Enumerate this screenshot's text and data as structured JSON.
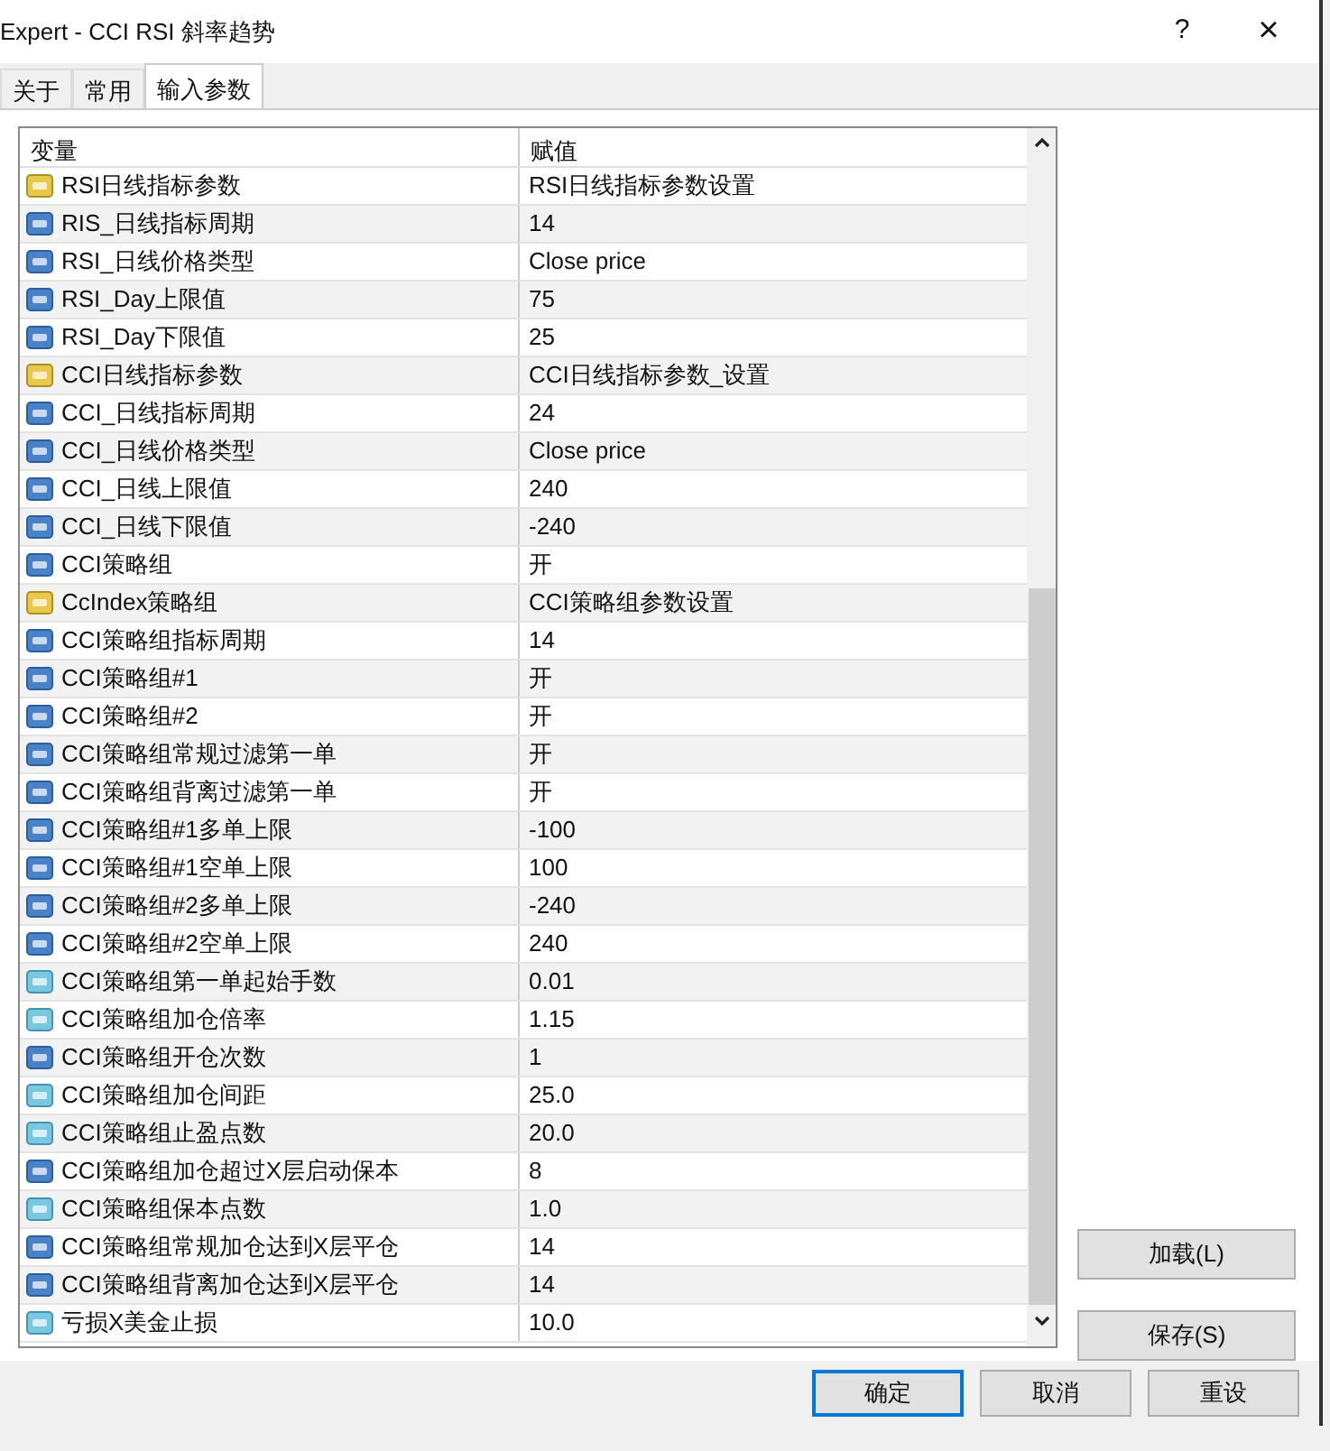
{
  "window": {
    "title": "Expert - CCI RSI 斜率趋势",
    "help": "?",
    "close": "×"
  },
  "tabs": [
    {
      "label": "关于",
      "selected": false
    },
    {
      "label": "常用",
      "selected": false
    },
    {
      "label": "输入参数",
      "selected": true
    }
  ],
  "table": {
    "columns": [
      "变量",
      "赋值"
    ],
    "rows": [
      {
        "kind": "string",
        "name": "RSI日线指标参数",
        "value": "RSI日线指标参数设置"
      },
      {
        "kind": "int",
        "name": "RIS_日线指标周期",
        "value": "14"
      },
      {
        "kind": "int",
        "name": "RSI_日线价格类型",
        "value": "Close price"
      },
      {
        "kind": "int",
        "name": "RSI_Day上限值",
        "value": "75"
      },
      {
        "kind": "int",
        "name": "RSI_Day下限值",
        "value": "25"
      },
      {
        "kind": "string",
        "name": "CCI日线指标参数",
        "value": "CCI日线指标参数_设置"
      },
      {
        "kind": "int",
        "name": "CCI_日线指标周期",
        "value": "24"
      },
      {
        "kind": "int",
        "name": "CCI_日线价格类型",
        "value": "Close price"
      },
      {
        "kind": "int",
        "name": "CCI_日线上限值",
        "value": "240"
      },
      {
        "kind": "int",
        "name": "CCI_日线下限值",
        "value": "-240"
      },
      {
        "kind": "int",
        "name": "CCI策略组",
        "value": "开"
      },
      {
        "kind": "string",
        "name": "CcIndex策略组",
        "value": "CCI策略组参数设置"
      },
      {
        "kind": "int",
        "name": "CCI策略组指标周期",
        "value": "14"
      },
      {
        "kind": "int",
        "name": "CCI策略组#1",
        "value": "开"
      },
      {
        "kind": "int",
        "name": "CCI策略组#2",
        "value": "开"
      },
      {
        "kind": "int",
        "name": "CCI策略组常规过滤第一单",
        "value": "开"
      },
      {
        "kind": "int",
        "name": "CCI策略组背离过滤第一单",
        "value": "开"
      },
      {
        "kind": "int",
        "name": "CCI策略组#1多单上限",
        "value": "-100"
      },
      {
        "kind": "int",
        "name": "CCI策略组#1空单上限",
        "value": "100"
      },
      {
        "kind": "int",
        "name": "CCI策略组#2多单上限",
        "value": "-240"
      },
      {
        "kind": "int",
        "name": "CCI策略组#2空单上限",
        "value": "240"
      },
      {
        "kind": "double",
        "name": "CCI策略组第一单起始手数",
        "value": "0.01"
      },
      {
        "kind": "double",
        "name": "CCI策略组加仓倍率",
        "value": "1.15"
      },
      {
        "kind": "int",
        "name": "CCI策略组开仓次数",
        "value": "1"
      },
      {
        "kind": "double",
        "name": "CCI策略组加仓间距",
        "value": "25.0"
      },
      {
        "kind": "double",
        "name": "CCI策略组止盈点数",
        "value": "20.0"
      },
      {
        "kind": "int",
        "name": "CCI策略组加仓超过X层启动保本",
        "value": "8"
      },
      {
        "kind": "double",
        "name": "CCI策略组保本点数",
        "value": "1.0"
      },
      {
        "kind": "int",
        "name": "CCI策略组常规加仓达到X层平仓",
        "value": "14"
      },
      {
        "kind": "int",
        "name": "CCI策略组背离加仓达到X层平仓",
        "value": "14"
      },
      {
        "kind": "double",
        "name": "亏损X美金止损",
        "value": "10.0"
      }
    ]
  },
  "side_buttons": [
    "加载(L)",
    "保存(S)"
  ],
  "buttons": [
    {
      "label": "确定",
      "focused": true
    },
    {
      "label": "取消",
      "focused": false
    },
    {
      "label": "重设",
      "focused": false
    }
  ]
}
